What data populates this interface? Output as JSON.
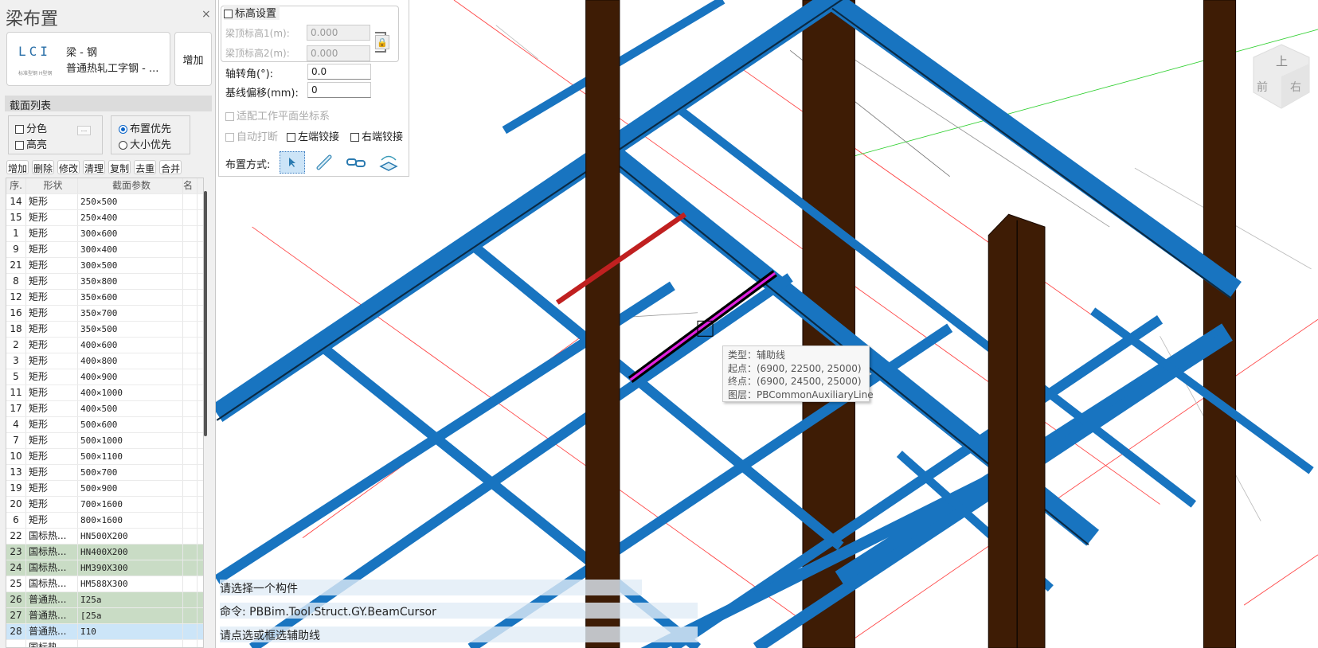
{
  "panel": {
    "title": "梁布置",
    "close_label": "×",
    "card": {
      "logo_glyphs": "LCI",
      "logo_caption": "标准型钢 H型钢",
      "line1": "梁 - 钢",
      "line2": "普通热轧工字钢 -  ..."
    },
    "add_label": "增加",
    "section_header": "截面列表",
    "options": {
      "color_split": "分色",
      "highlight": "高亮",
      "more": "...",
      "layout_priority": "布置优先",
      "size_priority": "大小优先"
    },
    "buttons": [
      "增加",
      "删除",
      "修改",
      "清理",
      "复制",
      "去重",
      "合并"
    ],
    "table": {
      "headers": [
        "序.",
        "形状",
        "截面参数",
        "名"
      ],
      "rows": [
        {
          "id": "14",
          "shape": "矩形",
          "param": "250×500",
          "state": ""
        },
        {
          "id": "15",
          "shape": "矩形",
          "param": "250×400",
          "state": ""
        },
        {
          "id": "1",
          "shape": "矩形",
          "param": "300×600",
          "state": ""
        },
        {
          "id": "9",
          "shape": "矩形",
          "param": "300×400",
          "state": ""
        },
        {
          "id": "21",
          "shape": "矩形",
          "param": "300×500",
          "state": ""
        },
        {
          "id": "8",
          "shape": "矩形",
          "param": "350×800",
          "state": ""
        },
        {
          "id": "12",
          "shape": "矩形",
          "param": "350×600",
          "state": ""
        },
        {
          "id": "16",
          "shape": "矩形",
          "param": "350×700",
          "state": ""
        },
        {
          "id": "18",
          "shape": "矩形",
          "param": "350×500",
          "state": ""
        },
        {
          "id": "2",
          "shape": "矩形",
          "param": "400×600",
          "state": ""
        },
        {
          "id": "3",
          "shape": "矩形",
          "param": "400×800",
          "state": ""
        },
        {
          "id": "5",
          "shape": "矩形",
          "param": "400×900",
          "state": ""
        },
        {
          "id": "11",
          "shape": "矩形",
          "param": "400×1000",
          "state": ""
        },
        {
          "id": "17",
          "shape": "矩形",
          "param": "400×500",
          "state": ""
        },
        {
          "id": "4",
          "shape": "矩形",
          "param": "500×600",
          "state": ""
        },
        {
          "id": "7",
          "shape": "矩形",
          "param": "500×1000",
          "state": ""
        },
        {
          "id": "10",
          "shape": "矩形",
          "param": "500×1100",
          "state": ""
        },
        {
          "id": "13",
          "shape": "矩形",
          "param": "500×700",
          "state": ""
        },
        {
          "id": "19",
          "shape": "矩形",
          "param": "500×900",
          "state": ""
        },
        {
          "id": "20",
          "shape": "矩形",
          "param": "700×1600",
          "state": ""
        },
        {
          "id": "6",
          "shape": "矩形",
          "param": "800×1600",
          "state": ""
        },
        {
          "id": "22",
          "shape": "国标热...",
          "param": "HN500X200",
          "state": ""
        },
        {
          "id": "23",
          "shape": "国标热...",
          "param": "HN400X200",
          "state": "green"
        },
        {
          "id": "24",
          "shape": "国标热...",
          "param": "HM390X300",
          "state": "green"
        },
        {
          "id": "25",
          "shape": "国标热...",
          "param": "HM588X300",
          "state": ""
        },
        {
          "id": "26",
          "shape": "普通热...",
          "param": "I25a",
          "state": "green"
        },
        {
          "id": "27",
          "shape": "普通热...",
          "param": "[25a",
          "state": "green"
        },
        {
          "id": "28",
          "shape": "普通热...",
          "param": "I10",
          "state": "sel"
        },
        {
          "id": "",
          "shape": "国标热...",
          "param": "",
          "state": ""
        }
      ]
    }
  },
  "settings": {
    "elevation_label": "标高设置",
    "top1_label": "梁顶标高1(m):",
    "top1_value": "0.000",
    "top2_label": "梁顶标高2(m):",
    "top2_value": "0.000",
    "rotation_label": "轴转角(°):",
    "rotation_value": "0.0",
    "offset_label": "基线偏移(mm):",
    "offset_value": "0",
    "fit_plane_label": "适配工作平面坐标系",
    "auto_break_label": "自动打断",
    "left_hinge_label": "左端铰接",
    "right_hinge_label": "右端铰接",
    "layout_mode_label": "布置方式:"
  },
  "tooltip": {
    "type": "类型：辅助线",
    "start": "起点：(6900, 22500, 25000)",
    "end": "终点：(6900, 24500, 25000)",
    "layer": "图层：PBCommonAuxiliaryLine"
  },
  "command": {
    "line1": "请选择一个构件",
    "line2": "命令: PBBim.Tool.Struct.GY.BeamCursor",
    "line3": "请点选或框选辅助线"
  },
  "viewcube": {
    "top": "上",
    "front": "前",
    "right": "右"
  },
  "colors": {
    "beam": "#1874c0",
    "column": "#3e1c05",
    "selected_beam": "#e020e0",
    "aux_red": "#ff3030"
  }
}
